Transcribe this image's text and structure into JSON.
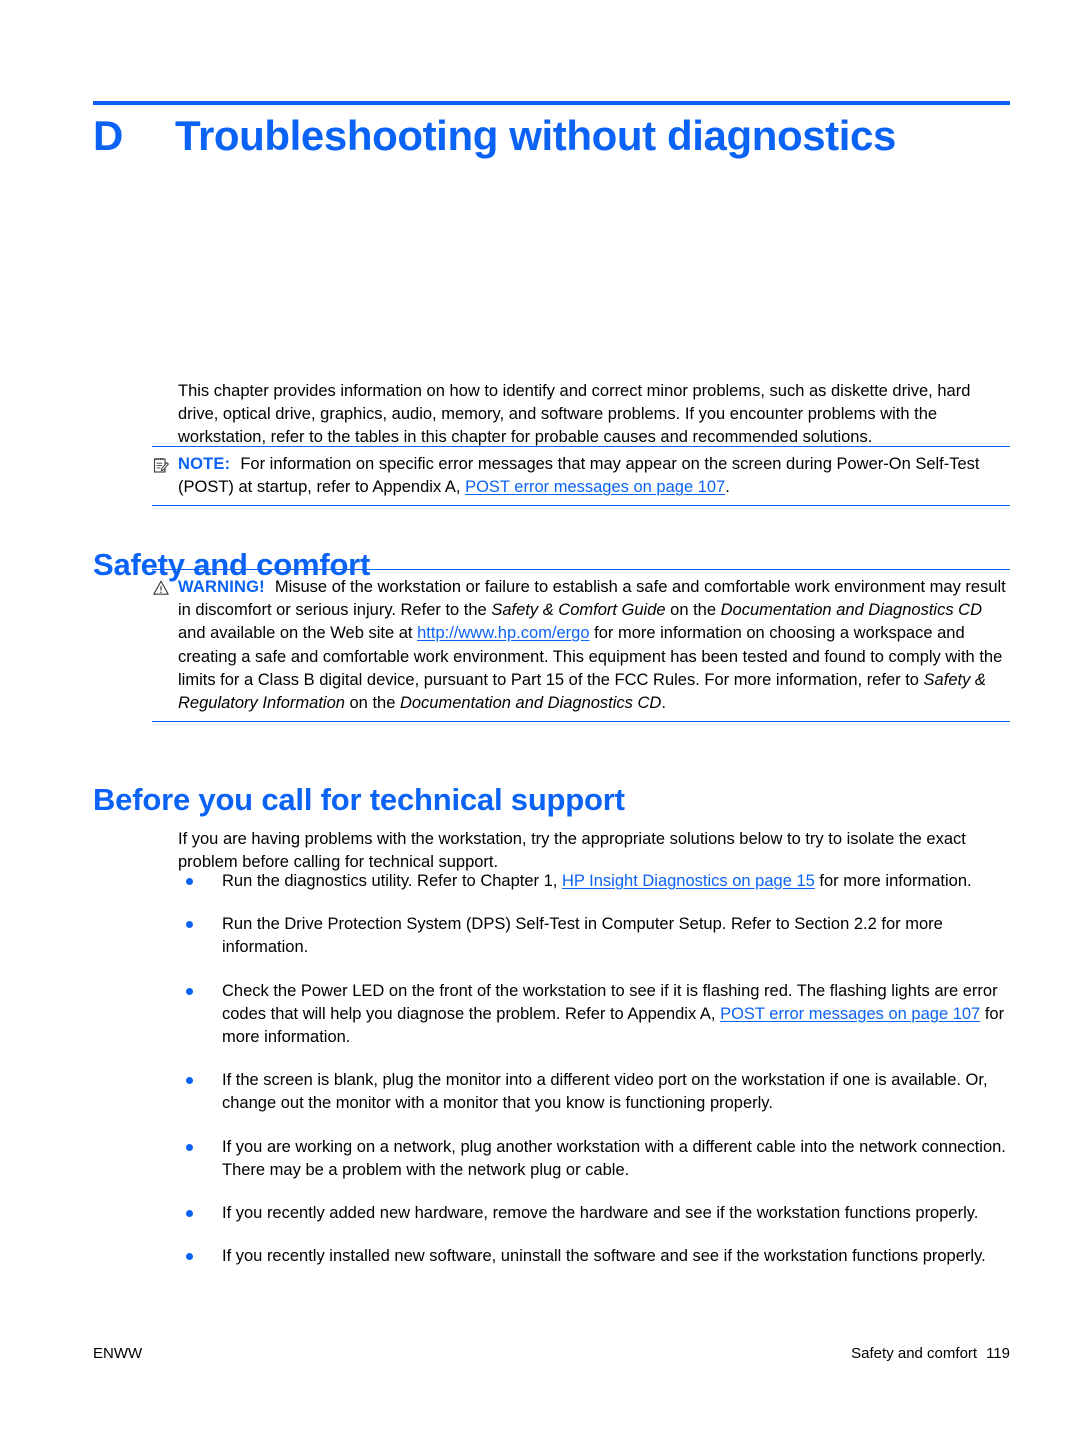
{
  "theme": {
    "accent": "#0b63f6",
    "text": "#000000",
    "background": "#ffffff"
  },
  "chapter": {
    "letter": "D",
    "title": "Troubleshooting without diagnostics"
  },
  "intro": {
    "text": "This chapter provides information on how to identify and correct minor problems, such as diskette drive, hard drive, optical drive, graphics, audio, memory, and software problems. If you encounter problems with the workstation, refer to the tables in this chapter for probable causes and recommended solutions."
  },
  "note": {
    "icon": "note-icon",
    "label": "NOTE:",
    "text_before_link": "For information on specific error messages that may appear on the screen during Power-On Self-Test (POST) at startup, refer to Appendix A, ",
    "link": "POST error messages on page 107",
    "text_after_link": "."
  },
  "sections": {
    "safety": {
      "heading": "Safety and comfort"
    },
    "before": {
      "heading": "Before you call for technical support",
      "paragraph": "If you are having problems with the workstation, try the appropriate solutions below to try to isolate the exact problem before calling for technical support."
    }
  },
  "warning": {
    "icon": "warning-triangle-icon",
    "label": "WARNING!",
    "part1": "Misuse of the workstation or failure to establish a safe and comfortable work environment may result in discomfort or serious injury. Refer to the ",
    "italic1": "Safety & Comfort Guide",
    "part2": " on the ",
    "italic2": "Documentation and Diagnostics CD",
    "part3": " and available on the Web site at ",
    "link": "http://www.hp.com/ergo",
    "part4": " for more information on choosing a workspace and creating a safe and comfortable work environment. This equipment has been tested and found to comply with the limits for a Class B digital device, pursuant to Part 15 of the FCC Rules. For more information, refer to ",
    "italic3": "Safety & Regulatory Information",
    "part5": " on the ",
    "italic4": "Documentation and Diagnostics CD",
    "part6": "."
  },
  "bullets": [
    {
      "before": "Run the diagnostics utility. Refer to Chapter 1, ",
      "link": "HP Insight Diagnostics on page 15",
      "after": " for more information."
    },
    {
      "before": "Run the Drive Protection System (DPS) Self-Test in Computer Setup. Refer to Section 2.2 for more information.",
      "link": "",
      "after": ""
    },
    {
      "before": "Check the Power LED on the front of the workstation to see if it is flashing red. The flashing lights are error codes that will help you diagnose the problem. Refer to Appendix A, ",
      "link": "POST error messages on page 107",
      "after": " for more information."
    },
    {
      "before": "If the screen is blank, plug the monitor into a different video port on the workstation if one is available. Or, change out the monitor with a monitor that you know is functioning properly.",
      "link": "",
      "after": ""
    },
    {
      "before": "If you are working on a network, plug another workstation with a different cable into the network connection. There may be a problem with the network plug or cable.",
      "link": "",
      "after": ""
    },
    {
      "before": "If you recently added new hardware, remove the hardware and see if the workstation functions properly.",
      "link": "",
      "after": ""
    },
    {
      "before": "If you recently installed new software, uninstall the software and see if the workstation functions properly.",
      "link": "",
      "after": ""
    }
  ],
  "footer": {
    "left": "ENWW",
    "section": "Safety and comfort",
    "page_number": "119"
  }
}
